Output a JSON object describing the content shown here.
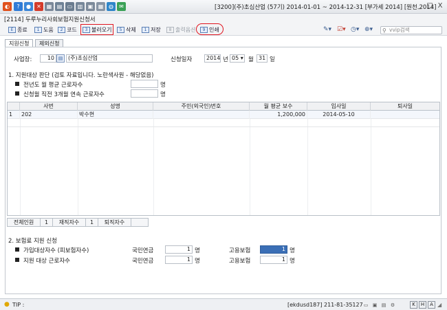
{
  "window": {
    "title": "[3200](주)초심산업 (57기) 2014-01-01 ~ 2014-12-31 [부가세 2014] [원천 2014]",
    "minimize": "_",
    "restore": "□",
    "close": "X"
  },
  "form": {
    "title": "[2114] 두루누리사회보험지원신청서"
  },
  "toolbar": {
    "close_label": "종료",
    "help_label": "도움",
    "code_label": "코드",
    "load_label": "불러오기",
    "delete_label": "삭제",
    "save_label": "저장",
    "output_label": "출력옵션",
    "print_label": "인쇄",
    "search_placeholder": "vvip검색"
  },
  "tabs": [
    "지원신청",
    "제외신청"
  ],
  "business": {
    "label": "사업장:",
    "code": "10",
    "name": "(주)초심산업"
  },
  "apply_date": {
    "label": "신청일자",
    "year": "2014",
    "year_unit": "년",
    "month": "05",
    "month_unit": "월",
    "day": "31",
    "day_unit": "일"
  },
  "section1": {
    "title": "1. 지원대상 판단 (검토 자료입니다. 노란색사원 - 해당없음)",
    "avg_workers_label": "전년도 월 평균 근로자수",
    "avg_workers_unit": "명",
    "recent_workers_label": "신청월 직전 3개월 연속 근로자수",
    "recent_workers_unit": "명"
  },
  "grid": {
    "columns": [
      "사번",
      "성명",
      "주민(외국인)번호",
      "월 평균 보수",
      "입사일",
      "퇴사일"
    ],
    "rows": [
      {
        "no": "1",
        "emp_id": "202",
        "name": "박수현",
        "resident_no": "",
        "avg_pay": "1,200,000",
        "join_date": "2014-05-10",
        "leave_date": ""
      }
    ]
  },
  "summary": {
    "total_label": "전체인원",
    "total_value": "1",
    "active_label": "재직자수",
    "active_value": "1",
    "retired_label": "퇴직자수",
    "retired_value": ""
  },
  "section2": {
    "title": "2. 보험료 지원 신청",
    "row1_label": "가입대상자수 (피보험자수)",
    "row2_label": "지원 대상 근로자수",
    "pension_label": "국민연금",
    "employment_label": "고용보험",
    "unit": "명",
    "row1_pension": "1",
    "row1_employment": "1",
    "row2_pension": "1",
    "row2_employment": "1"
  },
  "status": {
    "tip_label": "TIP :",
    "user_info": "[ekdusd187] 211-81-35127",
    "indicators": [
      "K",
      "H",
      "A"
    ]
  }
}
